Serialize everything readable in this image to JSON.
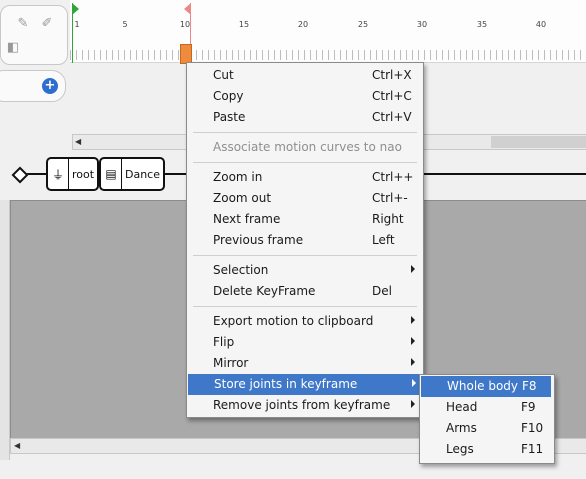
{
  "timeline": {
    "ruler_labels": [
      "1",
      "5",
      "10",
      "15",
      "20",
      "25",
      "30",
      "35",
      "40"
    ]
  },
  "flow": {
    "nodes": [
      {
        "label": "root"
      },
      {
        "label": "Dance"
      }
    ]
  },
  "context_menu": {
    "items": [
      {
        "label": "Cut",
        "shortcut": "Ctrl+X"
      },
      {
        "label": "Copy",
        "shortcut": "Ctrl+C"
      },
      {
        "label": "Paste",
        "shortcut": "Ctrl+V"
      },
      {
        "label": "Associate motion curves to nao",
        "disabled": true
      },
      {
        "label": "Zoom in",
        "shortcut": "Ctrl++"
      },
      {
        "label": "Zoom out",
        "shortcut": "Ctrl+-"
      },
      {
        "label": "Next frame",
        "shortcut": "Right"
      },
      {
        "label": "Previous frame",
        "shortcut": "Left"
      },
      {
        "label": "Selection",
        "has_submenu": true
      },
      {
        "label": "Delete KeyFrame",
        "shortcut": "Del"
      },
      {
        "label": "Export motion to clipboard",
        "has_submenu": true
      },
      {
        "label": "Flip",
        "has_submenu": true
      },
      {
        "label": "Mirror",
        "has_submenu": true
      },
      {
        "label": "Store joints in keyframe",
        "has_submenu": true,
        "highlighted": true
      },
      {
        "label": "Remove joints from keyframe",
        "has_submenu": true
      }
    ]
  },
  "submenu": {
    "items": [
      {
        "label": "Whole body",
        "shortcut": "F8",
        "highlighted": true
      },
      {
        "label": "Head",
        "shortcut": "F9"
      },
      {
        "label": "Arms",
        "shortcut": "F10"
      },
      {
        "label": "Legs",
        "shortcut": "F11"
      }
    ]
  },
  "colors": {
    "highlight": "#3f78c8",
    "keyframe": "#f08a3c",
    "start_marker": "#31a53a",
    "cursor_marker": "#e98a8a",
    "workspace": "#a9a9a9"
  }
}
